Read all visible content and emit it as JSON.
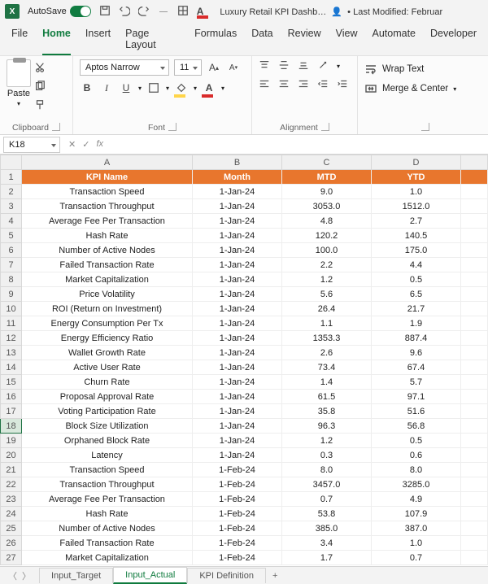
{
  "titlebar": {
    "autosave_label": "AutoSave",
    "doc_title": "Luxury Retail KPI Dashb…",
    "modified": "• Last Modified: Februar"
  },
  "menu": {
    "file": "File",
    "home": "Home",
    "insert": "Insert",
    "page_layout": "Page Layout",
    "formulas": "Formulas",
    "data": "Data",
    "review": "Review",
    "view": "View",
    "automate": "Automate",
    "developer": "Developer"
  },
  "ribbon": {
    "paste": "Paste",
    "font_name": "Aptos Narrow",
    "font_size": "11",
    "wrap": "Wrap Text",
    "merge": "Merge & Center",
    "group_clipboard": "Clipboard",
    "group_font": "Font",
    "group_alignment": "Alignment"
  },
  "fx": {
    "namebox": "K18",
    "fx_label": "fx"
  },
  "columns": [
    "A",
    "B",
    "C",
    "D"
  ],
  "header_row": {
    "A": "KPI Name",
    "B": "Month",
    "C": "MTD",
    "D": "YTD"
  },
  "rows": [
    {
      "n": 2,
      "A": "Transaction Speed",
      "B": "1-Jan-24",
      "C": "9.0",
      "D": "1.0"
    },
    {
      "n": 3,
      "A": "Transaction Throughput",
      "B": "1-Jan-24",
      "C": "3053.0",
      "D": "1512.0"
    },
    {
      "n": 4,
      "A": "Average Fee Per Transaction",
      "B": "1-Jan-24",
      "C": "4.8",
      "D": "2.7"
    },
    {
      "n": 5,
      "A": "Hash Rate",
      "B": "1-Jan-24",
      "C": "120.2",
      "D": "140.5"
    },
    {
      "n": 6,
      "A": "Number of Active Nodes",
      "B": "1-Jan-24",
      "C": "100.0",
      "D": "175.0"
    },
    {
      "n": 7,
      "A": "Failed Transaction Rate",
      "B": "1-Jan-24",
      "C": "2.2",
      "D": "4.4"
    },
    {
      "n": 8,
      "A": "Market Capitalization",
      "B": "1-Jan-24",
      "C": "1.2",
      "D": "0.5"
    },
    {
      "n": 9,
      "A": "Price Volatility",
      "B": "1-Jan-24",
      "C": "5.6",
      "D": "6.5"
    },
    {
      "n": 10,
      "A": "ROI (Return on Investment)",
      "B": "1-Jan-24",
      "C": "26.4",
      "D": "21.7"
    },
    {
      "n": 11,
      "A": "Energy Consumption Per Tx",
      "B": "1-Jan-24",
      "C": "1.1",
      "D": "1.9"
    },
    {
      "n": 12,
      "A": "Energy Efficiency Ratio",
      "B": "1-Jan-24",
      "C": "1353.3",
      "D": "887.4"
    },
    {
      "n": 13,
      "A": "Wallet Growth Rate",
      "B": "1-Jan-24",
      "C": "2.6",
      "D": "9.6"
    },
    {
      "n": 14,
      "A": "Active User Rate",
      "B": "1-Jan-24",
      "C": "73.4",
      "D": "67.4"
    },
    {
      "n": 15,
      "A": "Churn Rate",
      "B": "1-Jan-24",
      "C": "1.4",
      "D": "5.7"
    },
    {
      "n": 16,
      "A": "Proposal Approval Rate",
      "B": "1-Jan-24",
      "C": "61.5",
      "D": "97.1"
    },
    {
      "n": 17,
      "A": "Voting Participation Rate",
      "B": "1-Jan-24",
      "C": "35.8",
      "D": "51.6"
    },
    {
      "n": 18,
      "A": "Block Size Utilization",
      "B": "1-Jan-24",
      "C": "96.3",
      "D": "56.8"
    },
    {
      "n": 19,
      "A": "Orphaned Block Rate",
      "B": "1-Jan-24",
      "C": "1.2",
      "D": "0.5"
    },
    {
      "n": 20,
      "A": "Latency",
      "B": "1-Jan-24",
      "C": "0.3",
      "D": "0.6"
    },
    {
      "n": 21,
      "A": "Transaction Speed",
      "B": "1-Feb-24",
      "C": "8.0",
      "D": "8.0"
    },
    {
      "n": 22,
      "A": "Transaction Throughput",
      "B": "1-Feb-24",
      "C": "3457.0",
      "D": "3285.0"
    },
    {
      "n": 23,
      "A": "Average Fee Per Transaction",
      "B": "1-Feb-24",
      "C": "0.7",
      "D": "4.9"
    },
    {
      "n": 24,
      "A": "Hash Rate",
      "B": "1-Feb-24",
      "C": "53.8",
      "D": "107.9"
    },
    {
      "n": 25,
      "A": "Number of Active Nodes",
      "B": "1-Feb-24",
      "C": "385.0",
      "D": "387.0"
    },
    {
      "n": 26,
      "A": "Failed Transaction Rate",
      "B": "1-Feb-24",
      "C": "3.4",
      "D": "1.0"
    },
    {
      "n": 27,
      "A": "Market Capitalization",
      "B": "1-Feb-24",
      "C": "1.7",
      "D": "0.7"
    }
  ],
  "tabs": {
    "t1": "Input_Target",
    "t2": "Input_Actual",
    "t3": "KPI Definition",
    "add": "+"
  }
}
